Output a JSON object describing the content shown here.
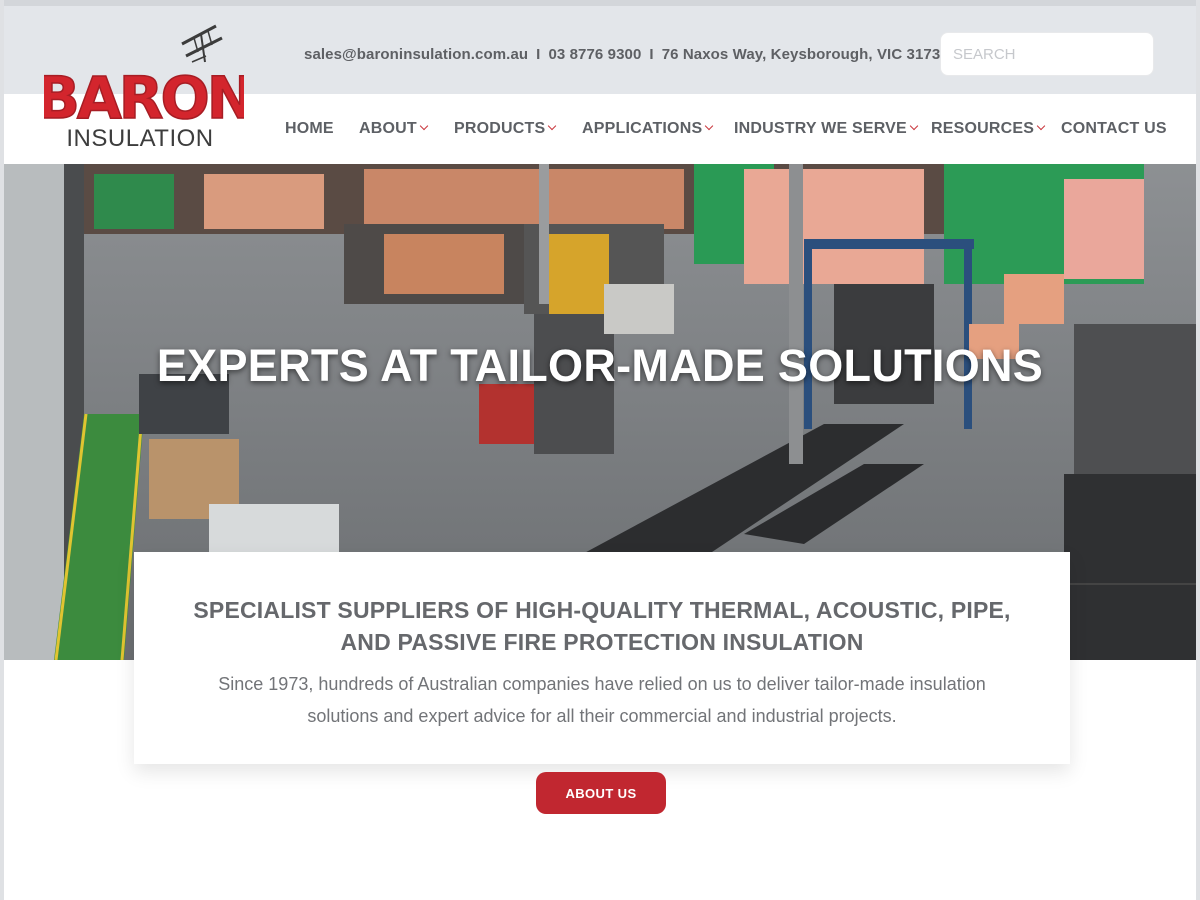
{
  "contact": {
    "email": "sales@baroninsulation.com.au",
    "phone": "03 8776 9300",
    "address": "76 Naxos Way, Keysborough, VIC 3173",
    "separator": "I"
  },
  "search": {
    "placeholder": "SEARCH"
  },
  "logo": {
    "brand": "BARON",
    "sub": "INSULATION"
  },
  "nav": {
    "home": "HOME",
    "about": "ABOUT",
    "products": "PRODUCTS",
    "applications": "APPLICATIONS",
    "industry": "INDUSTRY WE SERVE",
    "resources": "RESOURCES",
    "contact": "CONTACT US"
  },
  "hero": {
    "title": "EXPERTS AT TAILOR-MADE SOLUTIONS"
  },
  "card": {
    "title_line1": "SPECIALIST SUPPLIERS OF HIGH-QUALITY THERMAL, ACOUSTIC, PIPE,",
    "title_line2": "AND PASSIVE FIRE PROTECTION INSULATION",
    "text_line1": "Since 1973, hundreds of Australian companies have relied on us to deliver tailor-made insulation",
    "text_line2": "solutions and expert advice for all their commercial and industrial projects."
  },
  "cta": {
    "label": "ABOUT US"
  },
  "colors": {
    "brand_red": "#c12730",
    "topbar_bg": "#e3e6ea",
    "nav_text": "#5d6065"
  }
}
